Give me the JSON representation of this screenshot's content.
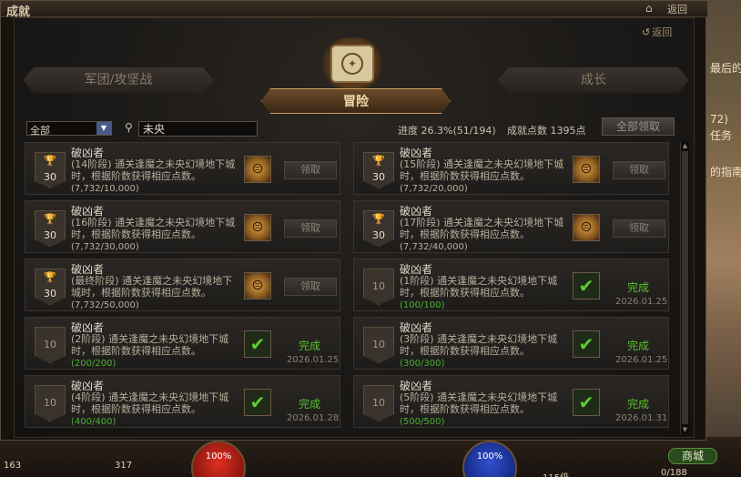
{
  "window": {
    "title": "成就",
    "home_icon": "home-icon",
    "back_label": "返回"
  },
  "inner": {
    "back_label": "返回"
  },
  "categories": {
    "left": "军团/攻坚战",
    "center": "冒险",
    "right": "成长"
  },
  "filter": {
    "category_value": "全部",
    "search_value": "未央"
  },
  "stats": {
    "progress_label": "进度 26.3%(51/194)",
    "points_label": "成就点数 1395点",
    "claim_all_label": "全部领取"
  },
  "achievements": [
    {
      "name": "破凶者",
      "desc": "(14阶段) 通关逢魔之未央幻境地下城时，根据阶数获得相应点数。",
      "progress": "(7,732/10,000)",
      "points": "30",
      "done": false,
      "action": "领取"
    },
    {
      "name": "破凶者",
      "desc": "(15阶段) 通关逢魔之未央幻境地下城时，根据阶数获得相应点数。",
      "progress": "(7,732/20,000)",
      "points": "30",
      "done": false,
      "action": "领取"
    },
    {
      "name": "破凶者",
      "desc": "(16阶段) 通关逢魔之未央幻境地下城时，根据阶数获得相应点数。",
      "progress": "(7,732/30,000)",
      "points": "30",
      "done": false,
      "action": "领取"
    },
    {
      "name": "破凶者",
      "desc": "(17阶段) 通关逢魔之未央幻境地下城时，根据阶数获得相应点数。",
      "progress": "(7,732/40,000)",
      "points": "30",
      "done": false,
      "action": "领取"
    },
    {
      "name": "破凶者",
      "desc": "(最终阶段) 通关逢魔之未央幻境地下城时，根据阶数获得相应点数。",
      "progress": "(7,732/50,000)",
      "points": "30",
      "done": false,
      "action": "领取"
    },
    {
      "name": "破凶者",
      "desc": "(1阶段) 通关逢魔之未央幻境地下城时，根据阶数获得相应点数。",
      "progress": "(100/100)",
      "points": "10",
      "done": true,
      "status": "完成",
      "date": "2026.01.25"
    },
    {
      "name": "破凶者",
      "desc": "(2阶段) 通关逢魔之未央幻境地下城时，根据阶数获得相应点数。",
      "progress": "(200/200)",
      "points": "10",
      "done": true,
      "status": "完成",
      "date": "2026.01.25"
    },
    {
      "name": "破凶者",
      "desc": "(3阶段) 通关逢魔之未央幻境地下城时，根据阶数获得相应点数。",
      "progress": "(300/300)",
      "points": "10",
      "done": true,
      "status": "完成",
      "date": "2026.01.25"
    },
    {
      "name": "破凶者",
      "desc": "(4阶段) 通关逢魔之未央幻境地下城时，根据阶数获得相应点数。",
      "progress": "(400/400)",
      "points": "10",
      "done": true,
      "status": "完成",
      "date": "2026.01.28"
    },
    {
      "name": "破凶者",
      "desc": "(5阶段) 通关逢魔之未央幻境地下城时，根据阶数获得相应点数。",
      "progress": "(500/500)",
      "points": "10",
      "done": true,
      "status": "完成",
      "date": "2026.01.31"
    }
  ],
  "side_text": {
    "line1": "最后的",
    "line2": "72)",
    "line3": "任务",
    "line4": "的指南"
  },
  "hud": {
    "hp_percent": "100%",
    "mp_percent": "100%",
    "shop_label": "商城",
    "counter_left": "163",
    "counter_mid": "317",
    "level": "115级",
    "inv": "0/188"
  }
}
